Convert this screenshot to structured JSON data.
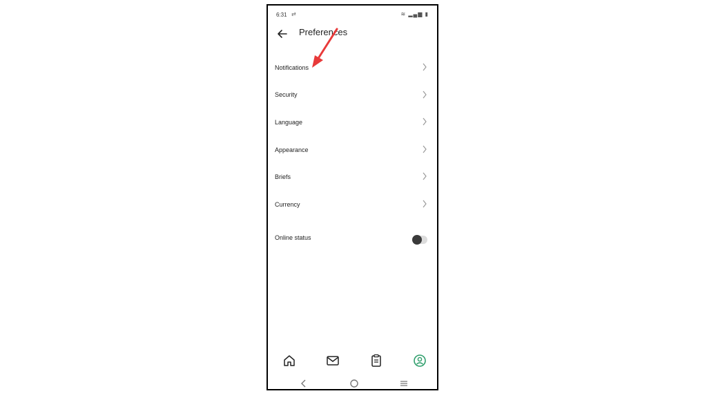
{
  "status_bar": {
    "time": "6:31",
    "extra_icon": "sync-icon",
    "icons": [
      "wifi-icon",
      "signal-icon",
      "battery-icon"
    ]
  },
  "header": {
    "title": "Preferences",
    "back_icon": "arrow-left-icon"
  },
  "menu": {
    "items": [
      {
        "label": "Notifications"
      },
      {
        "label": "Security"
      },
      {
        "label": "Language"
      },
      {
        "label": "Appearance"
      },
      {
        "label": "Briefs"
      },
      {
        "label": "Currency"
      }
    ],
    "chevron_icon": "chevron-right-icon"
  },
  "online_status": {
    "label": "Online status",
    "enabled": false
  },
  "bottom_nav": {
    "items": [
      "home-icon",
      "mail-icon",
      "clipboard-icon",
      "profile-icon"
    ],
    "active_color": "#2e9e6b"
  },
  "system_nav": [
    "back-icon",
    "home-circle-icon",
    "menu-icon"
  ],
  "annotation": {
    "arrow_color": "#e83a3a"
  }
}
